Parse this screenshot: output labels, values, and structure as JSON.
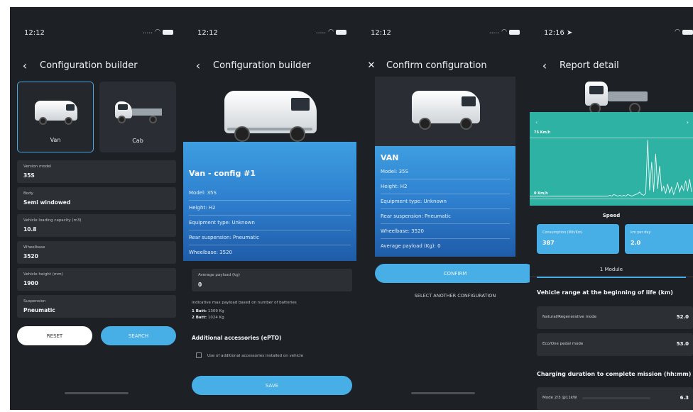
{
  "screens": [
    {
      "status_time": "12:12",
      "nav_title": "Configuration builder",
      "type_cards": [
        {
          "label": "Van",
          "selected": true
        },
        {
          "label": "Cab",
          "selected": false
        }
      ],
      "fields": [
        {
          "label": "Version model",
          "value": "35S"
        },
        {
          "label": "Body",
          "value": "Semi windowed"
        },
        {
          "label": "Vehicle loading capacity (m3)",
          "value": "10.8"
        },
        {
          "label": "Wheelbase",
          "value": "3520"
        },
        {
          "label": "Vehicle height (mm)",
          "value": "1900"
        },
        {
          "label": "Suspension",
          "value": "Pneumatic"
        }
      ],
      "reset_label": "RESET",
      "search_label": "SEARCH"
    },
    {
      "status_time": "12:12",
      "nav_title": "Configuration builder",
      "card_title": "Van - config #1",
      "card_rows": [
        "Model: 35S",
        "Height: H2",
        "Equipment type: Unknown",
        "Rear suspension: Pneumatic",
        "Wheelbase: 3520"
      ],
      "payload_label": "Average payload (kg)",
      "payload_value": "0",
      "indicative_text": "Indicative max payload based on number of batteries",
      "batt1_label": "1 Batt:",
      "batt1_value": "1309 Kg",
      "batt2_label": "2 Batt:",
      "batt2_value": "1024 Kg",
      "accessories_title": "Additional accessories (ePTO)",
      "accessories_checkbox": "Use of additional accessories installed on vehicle",
      "save_label": "SAVE"
    },
    {
      "status_time": "12:12",
      "nav_title": "Confirm configuration",
      "card_title": "VAN",
      "card_rows": [
        "Model: 35S",
        "Height: H2",
        "Equipment type: Unknown",
        "Rear suspension: Pneumatic",
        "Wheelbase: 3520",
        "Average payload (Kg): 0"
      ],
      "confirm_label": "CONFIRM",
      "select_another_label": "SELECT ANOTHER CONFIGURATION"
    },
    {
      "status_time": "12:16",
      "nav_title": "Report detail",
      "chart_top_label": "75 Km/h",
      "chart_bottom_label": "0 Km/h",
      "chart_caption": "Speed",
      "stats": [
        {
          "label": "Consumption (Wh/Km)",
          "value": "387"
        },
        {
          "label": "km per day",
          "value": "2.0"
        }
      ],
      "module_label": "1 Module",
      "range_title": "Vehicle range at the beginning of life (km)",
      "range_rows": [
        {
          "label": "Natural/Regenerative mode",
          "value": "52.0"
        },
        {
          "label": "Eco/One pedal mode",
          "value": "53.0"
        }
      ],
      "charging_title": "Charging duration to complete mission (hh:mm)",
      "charging_rows": [
        {
          "label": "Mode 2/3 @11kW",
          "value": "6.3"
        }
      ]
    }
  ],
  "colors": {
    "background": "#1d2024",
    "accent": "#47aee6",
    "chart": "#2eb2a3"
  },
  "chart_data": {
    "type": "line",
    "title": "",
    "ylabel": "",
    "y_top_label": "75 Km/h",
    "y_bottom_label": "0 Km/h",
    "caption": "Speed",
    "series": [
      {
        "values": [
          3,
          4,
          3,
          5,
          4,
          3,
          4,
          3,
          4,
          3,
          5,
          4,
          3,
          4,
          5,
          6,
          8,
          5,
          4,
          6,
          72,
          10,
          45,
          8,
          55,
          12,
          40,
          9,
          15,
          6,
          18,
          7,
          14,
          5,
          12,
          20,
          8,
          16,
          10,
          22,
          9,
          24,
          8
        ]
      }
    ],
    "ylim": [
      0,
      75
    ]
  }
}
